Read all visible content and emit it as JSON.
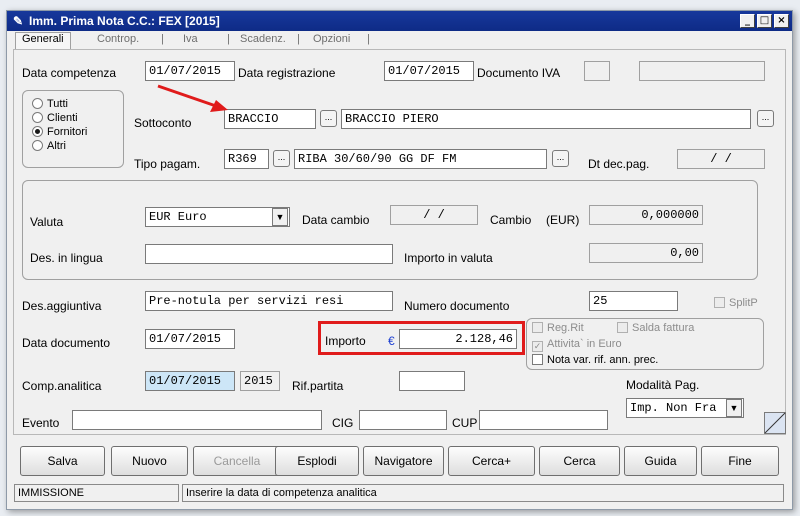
{
  "window": {
    "title": "Imm. Prima Nota C.C.: FEX [2015]",
    "minimize": "_",
    "maximize": "□",
    "close": "×"
  },
  "tabs": [
    "Generali",
    "Controp.",
    "Iva",
    "Scadenz.",
    "Opzioni"
  ],
  "tab_sep": "|",
  "row1": {
    "data_competenza_label": "Data competenza",
    "data_competenza": "01/07/2015",
    "data_registrazione_label": "Data registrazione",
    "data_registrazione": "01/07/2015",
    "documento_iva_label": "Documento IVA"
  },
  "radios": {
    "tutti": "Tutti",
    "clienti": "Clienti",
    "fornitori": "Fornitori",
    "altri": "Altri",
    "selected": "Fornitori"
  },
  "sottoconto": {
    "label": "Sottoconto",
    "code": "BRACCIO",
    "name": "BRACCIO PIERO",
    "lookup": "..."
  },
  "tipo_pagam": {
    "label": "Tipo pagam.",
    "code": "R369",
    "desc": "RIBA 30/60/90 GG DF FM",
    "lookup": "..."
  },
  "dt_dec_pag": {
    "label": "Dt dec.pag.",
    "value": "/  /"
  },
  "valuta": {
    "label": "Valuta",
    "value": "EUR Euro",
    "data_cambio_label": "Data cambio",
    "data_cambio": "/  /",
    "cambio_label": "Cambio",
    "cambio_unit": "(EUR)",
    "cambio": "0,000000"
  },
  "des_lingua": {
    "label": "Des. in lingua",
    "importo_valuta_label": "Importo in valuta",
    "importo_valuta": "0,00"
  },
  "des_aggiuntiva": {
    "label": "Des.aggiuntiva",
    "value": "Pre-notula per servizi resi",
    "numero_doc_label": "Numero documento",
    "numero_doc": "25",
    "splitp": "SplitP"
  },
  "data_documento": {
    "label": "Data documento",
    "value": "01/07/2015"
  },
  "importo": {
    "label": "Importo",
    "currency": "€",
    "value": "2.128,46"
  },
  "checks": {
    "reg_rit": "Reg.Rit",
    "salda_fattura": "Salda fattura",
    "attivita_euro": "Attivita` in Euro",
    "nota_var": "Nota var. rif. ann. prec."
  },
  "comp_analitica": {
    "label": "Comp.analitica",
    "date": "01/07/2015",
    "year": "2015",
    "rif_partita_label": "Rif.partita"
  },
  "modalita_pag": {
    "label": "Modalità Pag.",
    "value": "Imp. Non Fra"
  },
  "evento": {
    "label": "Evento",
    "cig_label": "CIG",
    "cup_label": "CUP"
  },
  "buttons": {
    "salva": "Salva",
    "nuovo": "Nuovo",
    "cancella": "Cancella",
    "esplodi": "Esplodi",
    "navigatore": "Navigatore",
    "cerca_plus": "Cerca+",
    "cerca": "Cerca",
    "guida": "Guida",
    "fine": "Fine"
  },
  "status": {
    "mode": "IMMISSIONE",
    "message": "Inserire la data di competenza analitica"
  },
  "colors": {
    "title_bar": "#0e2b86",
    "highlight_box": "#e01b1b",
    "arrow": "#e01b1b",
    "field_highlight": "#cde6f7"
  }
}
